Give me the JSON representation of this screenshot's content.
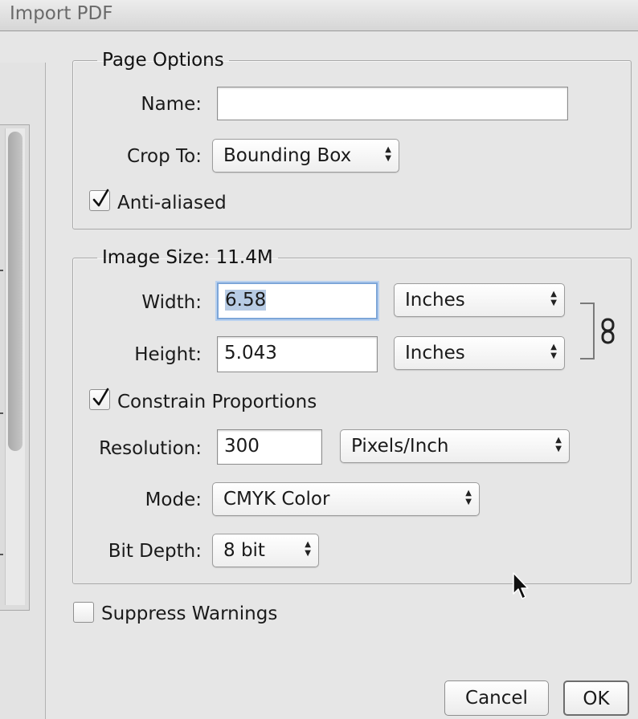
{
  "window": {
    "title": "Import PDF"
  },
  "page_options": {
    "legend": "Page Options",
    "name": {
      "label": "Name:",
      "value": ""
    },
    "crop_to": {
      "label": "Crop To:",
      "selected": "Bounding Box"
    },
    "anti_aliased": {
      "label": "Anti-aliased",
      "checked": true
    }
  },
  "image_size": {
    "legend": "Image Size: 11.4M",
    "width": {
      "label": "Width:",
      "value": "6.58",
      "unit": "Inches"
    },
    "height": {
      "label": "Height:",
      "value": "5.043",
      "unit": "Inches"
    },
    "constrain_proportions": {
      "label": "Constrain Proportions",
      "checked": true
    },
    "resolution": {
      "label": "Resolution:",
      "value": "300",
      "unit": "Pixels/Inch"
    },
    "mode": {
      "label": "Mode:",
      "selected": "CMYK Color"
    },
    "bit_depth": {
      "label": "Bit Depth:",
      "selected": "8 bit"
    }
  },
  "suppress_warnings": {
    "label": "Suppress Warnings",
    "checked": false
  },
  "buttons": {
    "cancel": "Cancel",
    "ok": "OK"
  },
  "icons": {
    "dropdown_arrows": "up-down-chevron-icon",
    "link": "chain-link-icon",
    "checkmark": "checkmark-icon",
    "cursor": "mouse-pointer-icon"
  }
}
